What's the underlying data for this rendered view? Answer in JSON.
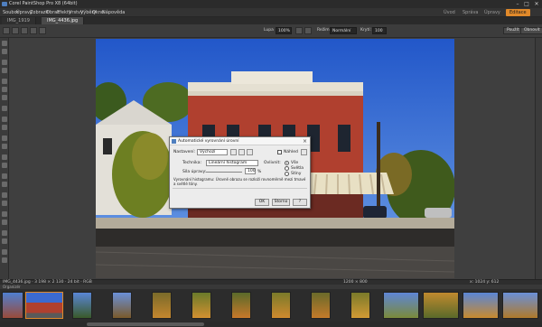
{
  "window": {
    "title": "Corel PaintShop Pro X8 (64bit)",
    "min": "–",
    "max": "□",
    "close": "✕"
  },
  "menu": {
    "items": [
      "Soubor",
      "Úpravy",
      "Zobrazit",
      "Obraz",
      "Efekty",
      "Vrstvy",
      "Výběry",
      "Okno",
      "Nápověda"
    ],
    "modes": [
      "Úvod",
      "Správa",
      "Úpravy",
      "Editace"
    ],
    "active_mode": "Úpravy",
    "quick": [
      "Palety",
      "Nástroje"
    ]
  },
  "tabs": [
    {
      "label": "IMG_1919",
      "active": false
    },
    {
      "label": "IMG_4436.jpg",
      "active": true
    }
  ],
  "toolbar": {
    "mode_label": "Režim:",
    "mode_value": "Normální",
    "opacity_label": "Krytí:",
    "opacity_value": "100",
    "zoom_label": "Lupa",
    "zoom_value": "100%",
    "apply": "Použít",
    "reset": "Obnovit"
  },
  "dialog": {
    "title": "Automatické vyrovnání úrovní",
    "preset_label": "Nastavení:",
    "preset_value": "Výchozí",
    "preview_label": "Náhled",
    "method_label": "Technika:",
    "method_value": "Lineární histogram",
    "adjust_label": "Ovlivnit:",
    "strength_label": "Síla úpravy:",
    "strength_value": "100",
    "options": [
      "Vše",
      "Světla",
      "Stíny"
    ],
    "selected_option": "Vše",
    "description": "Vyrovnání histogramu: Úrovně obrazu se rozloží rovnoměrně mezi tmavé a světlé tóny.",
    "ok": "OK",
    "cancel": "Storno",
    "help": "Nápověda"
  },
  "status": {
    "left": "IMG_4436.jpg · 3 198 × 2 130 · 24 bit · RGB",
    "center": "1200 × 800",
    "right": "x: 1024 y: 612"
  },
  "panel": {
    "title": "Organizér"
  },
  "filmstrip": {
    "count": 14,
    "selected_index": 1
  },
  "colors": {
    "accent": "#e0892a",
    "sky": "#2f6ad8",
    "brick": "#b0402f",
    "chrome": "#3a3a3a"
  }
}
